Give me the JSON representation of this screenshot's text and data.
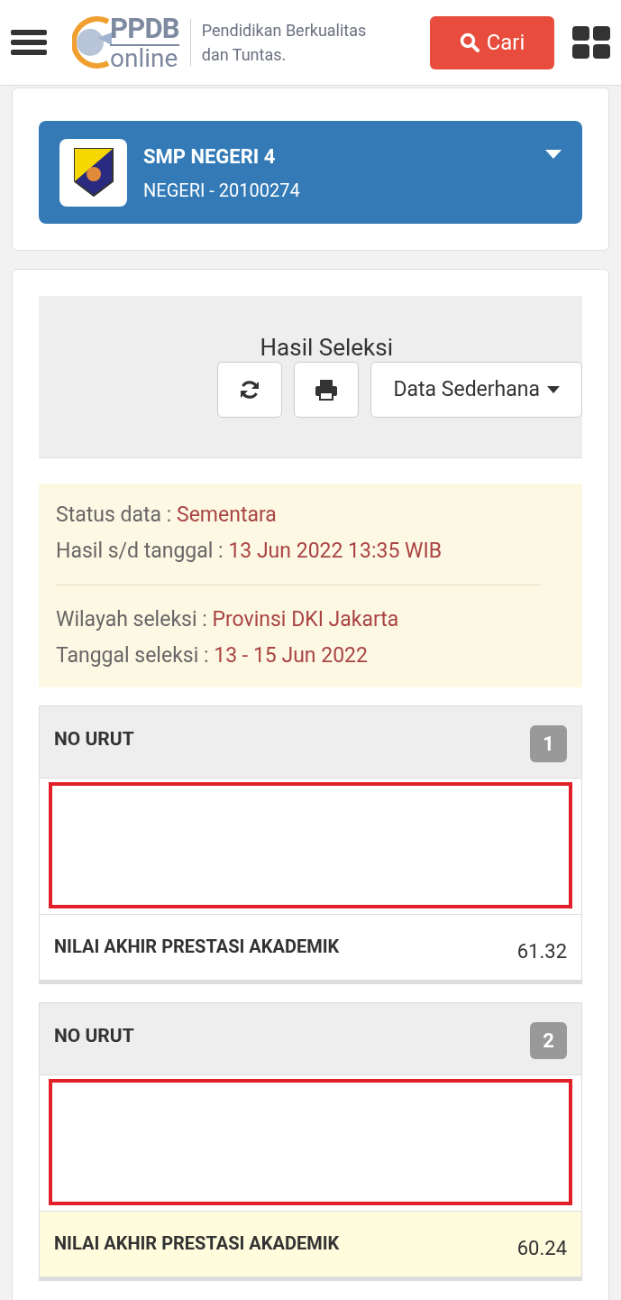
{
  "header": {
    "logo": {
      "top": "PPDB",
      "bottom": "online"
    },
    "tagline": "Pendidikan Berkualitas dan Tuntas.",
    "search_button": "Cari"
  },
  "school": {
    "name": "SMP NEGERI 4",
    "subtitle": "NEGERI - 20100274",
    "expanded": false
  },
  "results": {
    "title": "Hasil Seleksi",
    "view_dropdown": "Data Sederhana",
    "info": [
      {
        "label": "Status data : ",
        "value": "Sementara"
      },
      {
        "label": "Hasil s/d tanggal : ",
        "value": "13 Jun 2022 13:35 WIB"
      },
      {
        "label": "Wilayah seleksi : ",
        "value": "Provinsi DKI Jakarta"
      },
      {
        "label": "Tanggal seleksi : ",
        "value": "13 - 15 Jun 2022"
      }
    ],
    "records": [
      {
        "heading": "NO URUT",
        "number": "1",
        "score_label": "NILAI AKHIR PRESTASI AKADEMIK",
        "score": "61.32",
        "highlighted": false
      },
      {
        "heading": "NO URUT",
        "number": "2",
        "score_label": "NILAI AKHIR PRESTASI AKADEMIK",
        "score": "60.24",
        "highlighted": true
      }
    ]
  }
}
